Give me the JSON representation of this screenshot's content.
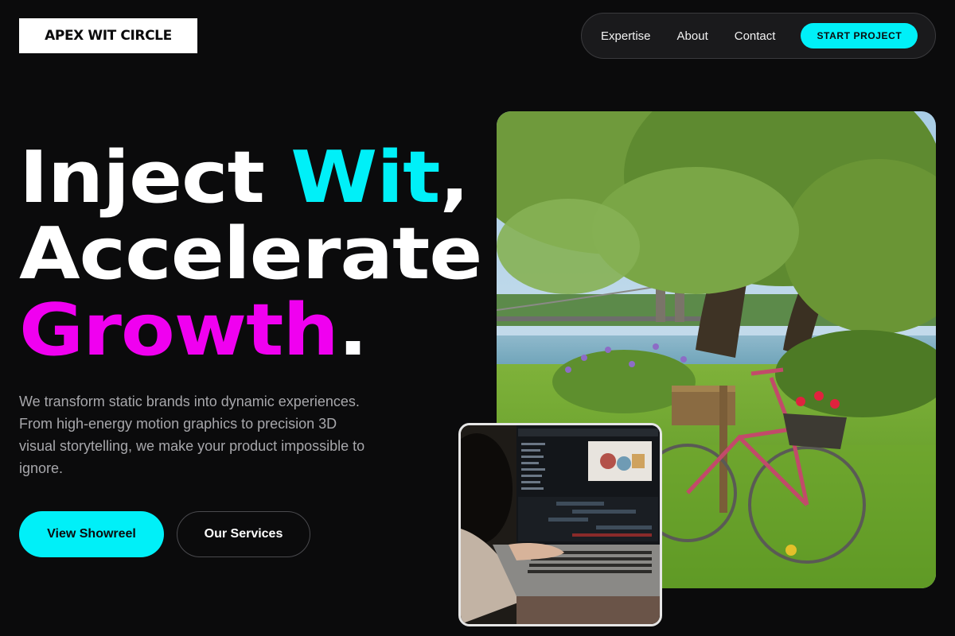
{
  "brand": {
    "name": "APEX WIT CIRCLE"
  },
  "nav": {
    "links": [
      "Expertise",
      "About",
      "Contact"
    ],
    "cta_label": "START PROJECT"
  },
  "hero": {
    "headline": {
      "part1": "Inject ",
      "accent1": "Wit",
      "part2": ",",
      "line2": "Accelerate",
      "accent2": "Growth",
      "part3": "."
    },
    "description": "We transform static brands into dynamic experiences. From high-energy motion graphics to precision 3D visual storytelling, we make your product impossible to ignore.",
    "primary_button": "View Showreel",
    "secondary_button": "Our Services"
  },
  "colors": {
    "background": "#0b0b0c",
    "accent_cyan": "#00f0f8",
    "accent_magenta": "#f000f0",
    "text_muted": "#a7a7ab"
  },
  "images": {
    "hero_icon": "riverside-bicycle-photo",
    "inset_icon": "laptop-video-editing-photo"
  }
}
